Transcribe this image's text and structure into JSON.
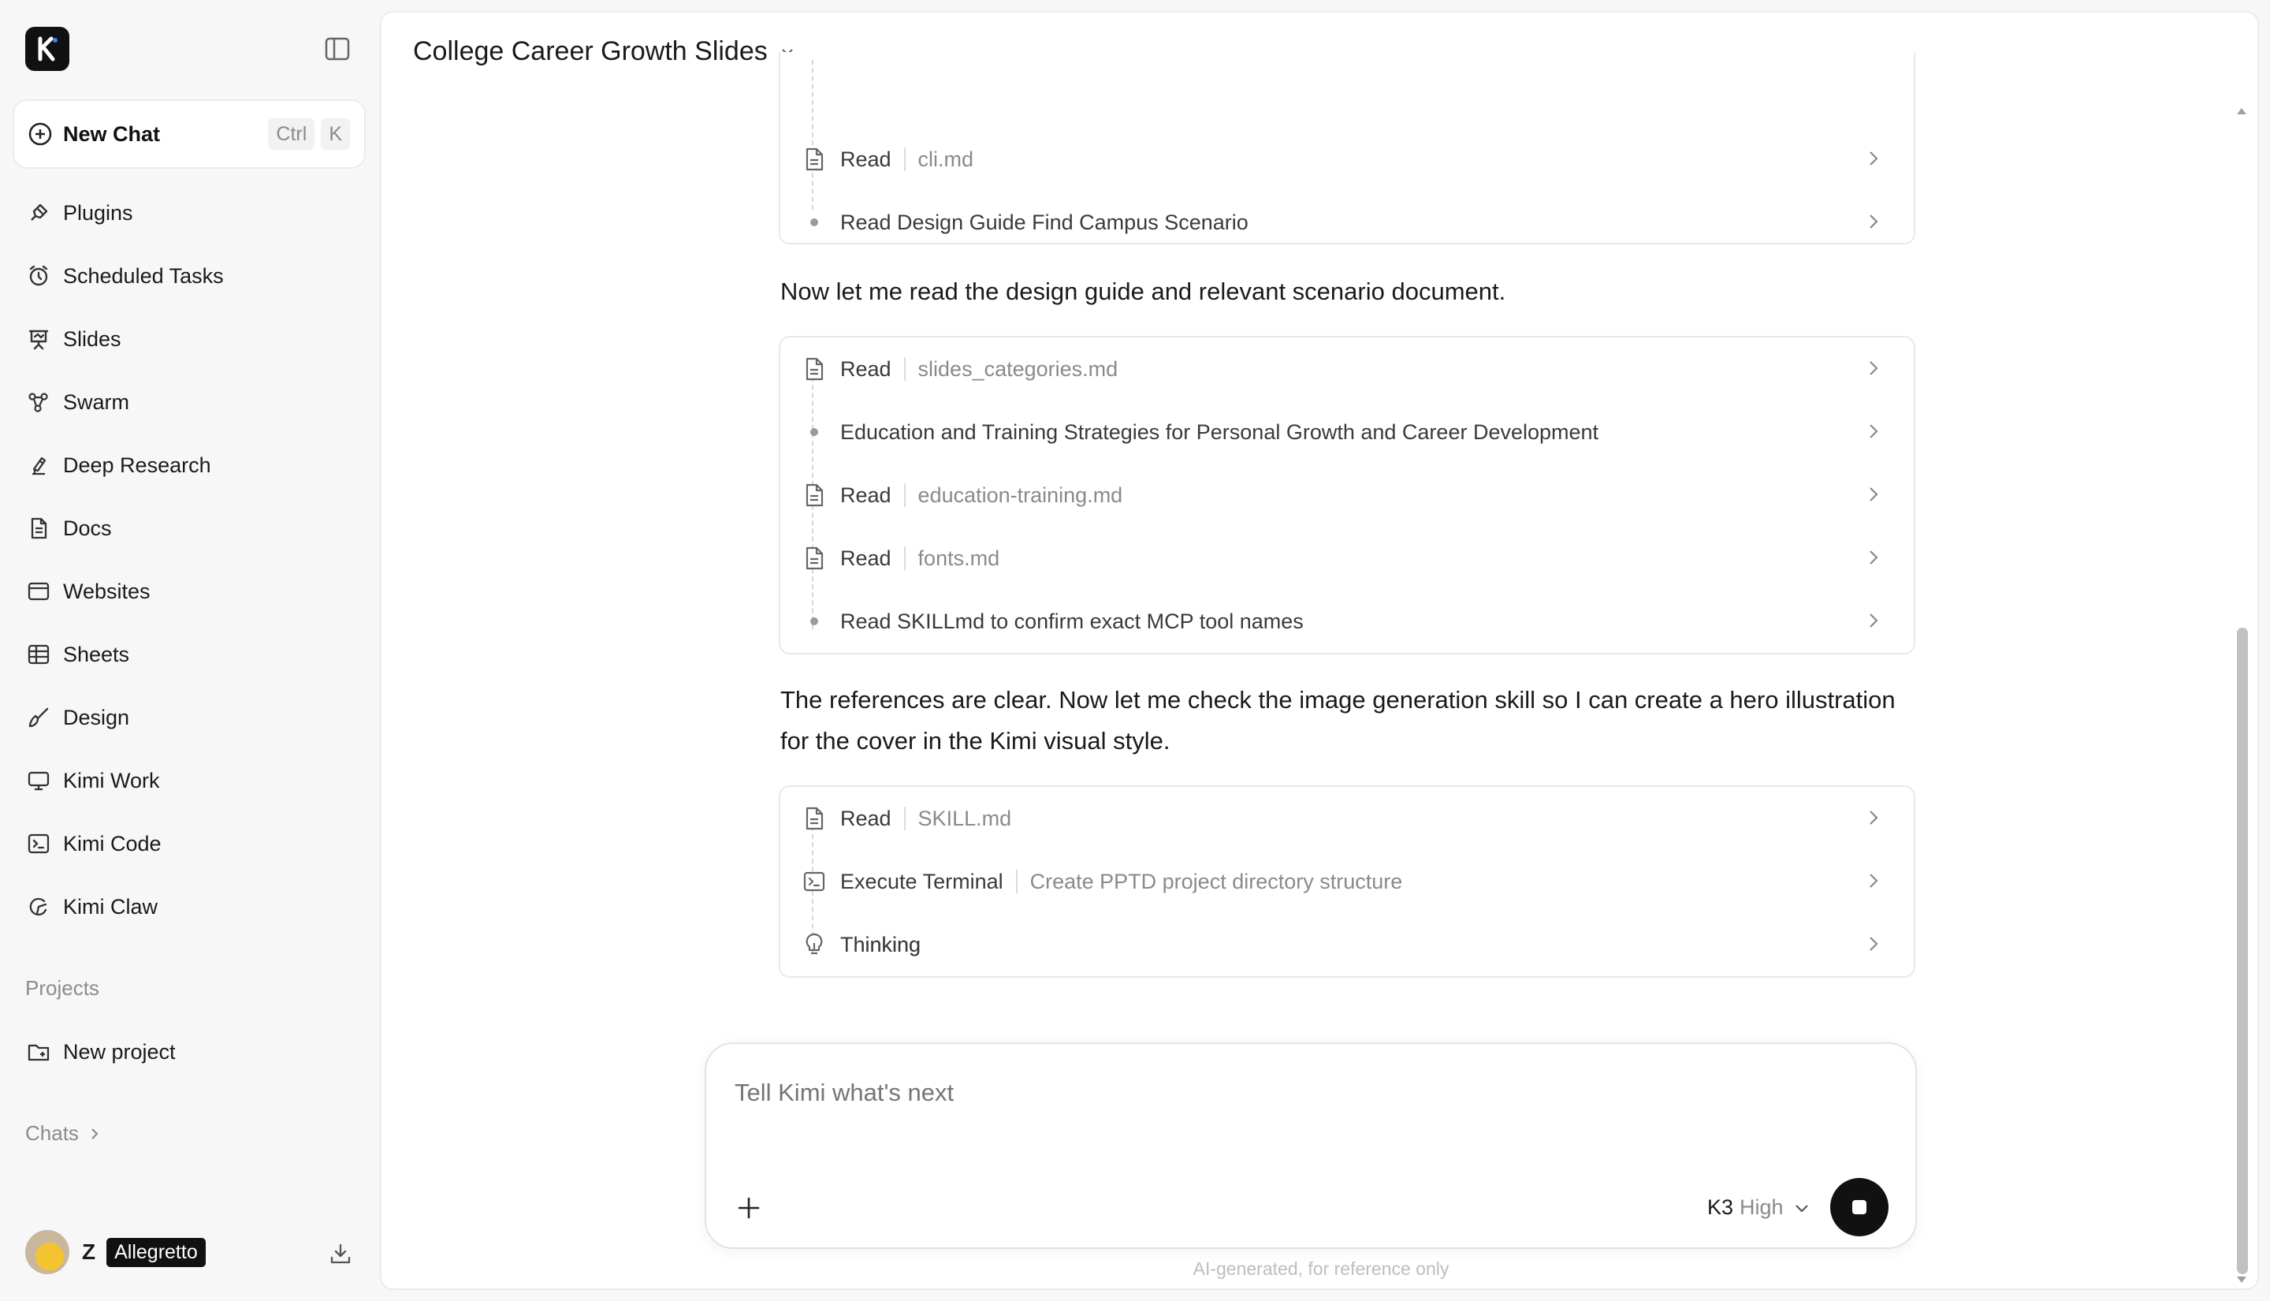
{
  "sidebar": {
    "logo_letter": "K",
    "new_chat": {
      "label": "New Chat",
      "shortcut": [
        "Ctrl",
        "K"
      ]
    },
    "items": [
      {
        "label": "Plugins",
        "icon": "plug-icon"
      },
      {
        "label": "Scheduled Tasks",
        "icon": "alarm-clock-icon"
      },
      {
        "label": "Slides",
        "icon": "presentation-icon"
      },
      {
        "label": "Swarm",
        "icon": "swarm-icon"
      },
      {
        "label": "Deep Research",
        "icon": "research-icon"
      },
      {
        "label": "Docs",
        "icon": "document-icon"
      },
      {
        "label": "Websites",
        "icon": "browser-window-icon"
      },
      {
        "label": "Sheets",
        "icon": "table-icon"
      },
      {
        "label": "Design",
        "icon": "brush-icon"
      },
      {
        "label": "Kimi Work",
        "icon": "monitor-icon"
      },
      {
        "label": "Kimi Code",
        "icon": "terminal-icon"
      },
      {
        "label": "Kimi Claw",
        "icon": "claw-icon"
      }
    ],
    "projects_label": "Projects",
    "new_project": "New project",
    "chats_label": "Chats",
    "user": {
      "initial": "Z",
      "badge": "Allegretto"
    }
  },
  "header": {
    "title": "College Career Growth Slides"
  },
  "conversation": {
    "card1": [
      {
        "type": "read",
        "action": "Read",
        "arg": "cli.md"
      },
      {
        "type": "step",
        "desc": "Read Design Guide Find Campus Scenario"
      }
    ],
    "msg1": "Now let me read the design guide and relevant scenario document.",
    "card2": [
      {
        "type": "read",
        "action": "Read",
        "arg": "slides_categories.md"
      },
      {
        "type": "step",
        "desc": "Education and Training Strategies for Personal Growth and Career Development"
      },
      {
        "type": "read",
        "action": "Read",
        "arg": "education-training.md"
      },
      {
        "type": "read",
        "action": "Read",
        "arg": "fonts.md"
      },
      {
        "type": "step",
        "desc": "Read SKILLmd to confirm exact MCP tool names"
      }
    ],
    "msg2": "The references are clear. Now let me check the image generation skill so I can create a hero illustration for the cover in the Kimi visual style.",
    "card3": [
      {
        "type": "read",
        "action": "Read",
        "arg": "SKILL.md"
      },
      {
        "type": "terminal",
        "action": "Execute Terminal",
        "arg": "Create PPTD project directory structure"
      },
      {
        "type": "thinking",
        "action": "Thinking"
      }
    ]
  },
  "composer": {
    "placeholder": "Tell Kimi what's next",
    "model": "K3",
    "effort": "High"
  },
  "footer_note": "AI-generated, for reference only"
}
